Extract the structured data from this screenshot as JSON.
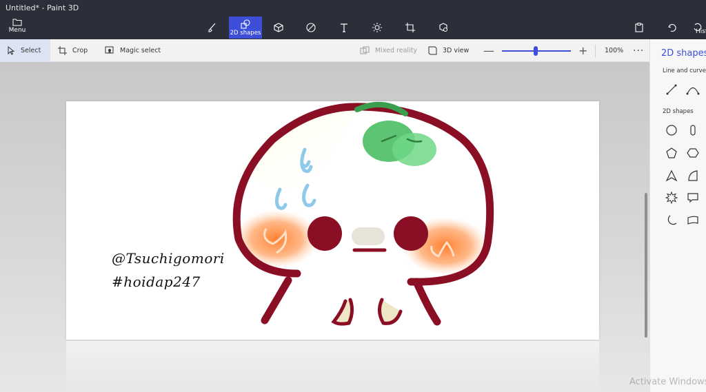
{
  "window": {
    "title": "Untitled* - Paint 3D"
  },
  "toolbar": {
    "menu_label": "Menu",
    "active_tool_label": "2D shapes",
    "history_label": "Hist"
  },
  "subbar": {
    "select_label": "Select",
    "crop_label": "Crop",
    "magic_select_label": "Magic select",
    "mixed_reality_label": "Mixed reality",
    "view_3d_label": "3D view",
    "zoom_minus": "—",
    "zoom_plus": "+",
    "zoom_value": "100%",
    "more": "···"
  },
  "panel": {
    "title": "2D shapes",
    "line_section": "Line and curve",
    "shapes_section": "2D shapes"
  },
  "canvas": {
    "signature_line1": "@Tsuchigomori",
    "signature_line2": "#hoidap247"
  },
  "system": {
    "watermark": "Activate Windows"
  },
  "colors": {
    "accent": "#3d4ed8",
    "title_bar": "#2b2f3a",
    "drawing_outline": "#8b0f24",
    "drawing_leaf": "#5cc472",
    "drawing_blush": "#ff8a3d"
  }
}
